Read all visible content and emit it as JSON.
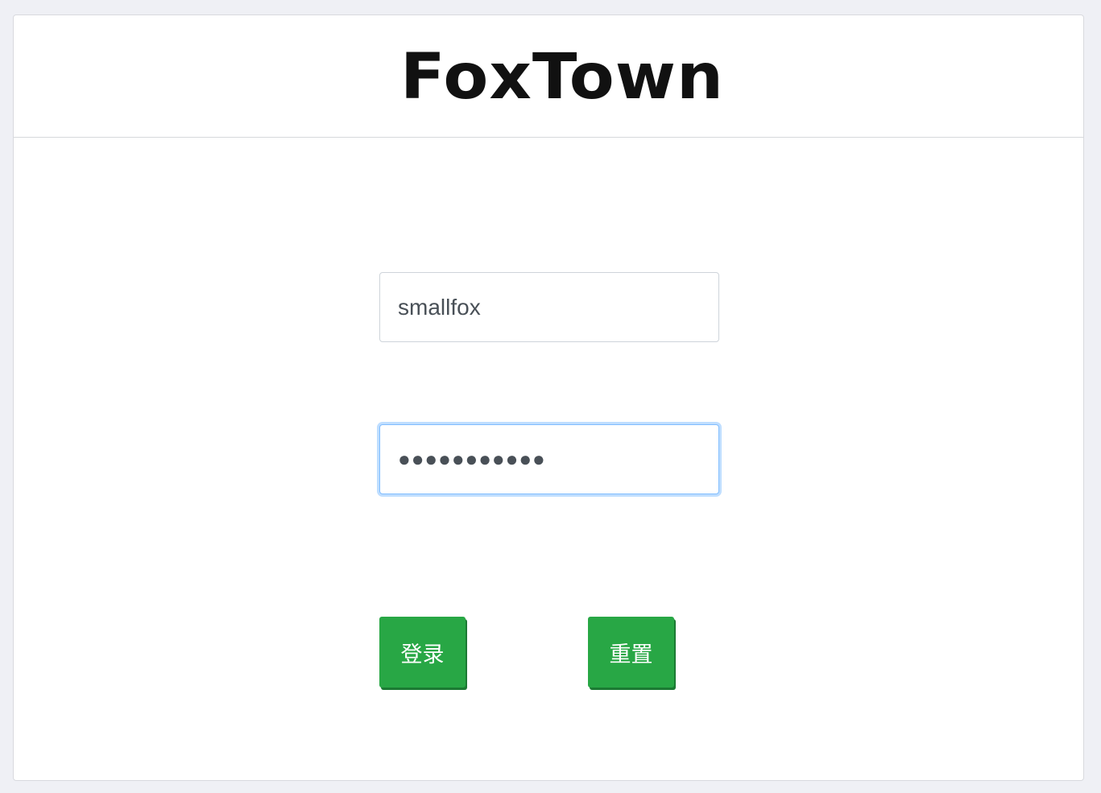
{
  "header": {
    "logo_text": "FoxTown"
  },
  "form": {
    "username_value": "smallfox",
    "password_mask": "●●●●●●●●●●●",
    "login_label": "登录",
    "reset_label": "重置"
  },
  "colors": {
    "button_green": "#28a745",
    "focus_blue": "#80bdff",
    "page_background": "#eff0f5"
  }
}
